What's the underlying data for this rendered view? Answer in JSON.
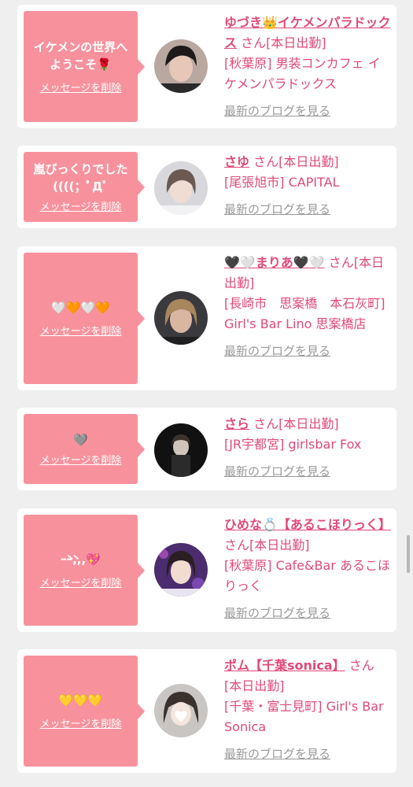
{
  "delete_label": "メッセージを削除",
  "blog_label": "最新のブログを見る",
  "san_label": "さん",
  "cards": [
    {
      "message": "イケメンの世界へ\nようこそ🌹",
      "name": "ゆづき👑イケメンパラドックス",
      "status": "[本日出勤]",
      "shop": "[秋葉原] 男装コンカフェ イケメンパラドックス"
    },
    {
      "message": "嵐びっくりでした\n((((；ﾟДﾟ",
      "name": "さゆ",
      "status": "[本日出勤]",
      "shop": "[尾張旭市] CAPITAL"
    },
    {
      "message": "🤍🧡🤍🧡",
      "name": "🖤🤍まりあ🖤🤍",
      "status": "[本日出勤]",
      "shop": "[長崎市　思案橋　本石灰町] Girl's Bar Lino 思案橋店"
    },
    {
      "message": "🩶",
      "name": "さら",
      "status": "[本日出勤]",
      "shop": "[JR宇都宮] girlsbar Fox"
    },
    {
      "message": "ｰ̀ｰ̀,,,💖",
      "name": "ひめな💍【あるこほりっく】",
      "status": "[本日出勤]",
      "shop": "[秋葉原] Cafe&Bar あるこほりっく"
    },
    {
      "message": "💛💛💛",
      "name": "ポム【千葉sonica】",
      "status": "[本日出勤]",
      "shop": "[千葉・富士見町] Girl's Bar Sonica"
    }
  ],
  "colors": {
    "bubble": "#f7929d",
    "accent": "#e04a79",
    "link_gray": "#999999"
  }
}
